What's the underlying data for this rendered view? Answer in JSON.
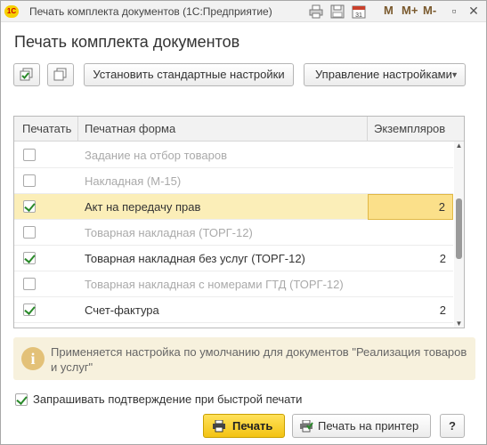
{
  "window": {
    "title": "Печать комплекта документов  (1С:Предприятие)",
    "logo_text": "1С",
    "m_buttons": [
      "M",
      "M+",
      "M-"
    ]
  },
  "heading": "Печать комплекта документов",
  "toolbar": {
    "set_default_label": "Установить стандартные настройки",
    "manage_settings_label": "Управление настройками"
  },
  "table": {
    "columns": [
      "Печатать",
      "Печатная форма",
      "Экземпляров"
    ],
    "rows": [
      {
        "checked": false,
        "name": "Задание на отбор товаров",
        "copies": "",
        "active": false
      },
      {
        "checked": false,
        "name": "Накладная (М-15)",
        "copies": "",
        "active": false
      },
      {
        "checked": true,
        "name": "Акт на передачу прав",
        "copies": "2",
        "active": true
      },
      {
        "checked": false,
        "name": "Товарная накладная (ТОРГ-12)",
        "copies": "",
        "active": false
      },
      {
        "checked": true,
        "name": "Товарная накладная без услуг (ТОРГ-12)",
        "copies": "2",
        "active": true
      },
      {
        "checked": false,
        "name": "Товарная накладная с номерами ГТД (ТОРГ-12)",
        "copies": "",
        "active": false
      },
      {
        "checked": true,
        "name": "Счет-фактура",
        "copies": "2",
        "active": true
      }
    ]
  },
  "info": {
    "text": "Применяется настройка по умолчанию для документов \"Реализация товаров и услуг\""
  },
  "confirm": {
    "checked": true,
    "label": "Запрашивать подтверждение при быстрой печати"
  },
  "footer": {
    "print_label": "Печать",
    "print_to_printer_label": "Печать на принтер",
    "help_label": "?"
  },
  "colors": {
    "selected_row": "#fbeeb8",
    "primary_button": "#f3c313",
    "check_mark": "#2a8a2a"
  }
}
